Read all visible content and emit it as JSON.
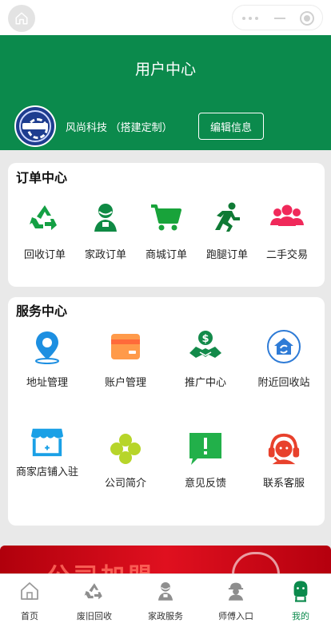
{
  "header": {
    "title": "用户中心",
    "user_name": "风尚科技 （搭建定制）",
    "edit_label": "编辑信息"
  },
  "orders": {
    "title": "订单中心",
    "items": [
      {
        "label": "回收订单",
        "icon": "recycle-icon"
      },
      {
        "label": "家政订单",
        "icon": "housekeeper-icon"
      },
      {
        "label": "商城订单",
        "icon": "cart-icon"
      },
      {
        "label": "跑腿订单",
        "icon": "runner-icon"
      },
      {
        "label": "二手交易",
        "icon": "people-group-icon"
      }
    ]
  },
  "services": {
    "title": "服务中心",
    "items": [
      {
        "label": "地址管理",
        "icon": "location-pin-icon"
      },
      {
        "label": "账户管理",
        "icon": "wallet-card-icon"
      },
      {
        "label": "推广中心",
        "icon": "money-handshake-icon"
      },
      {
        "label": "附近回收站",
        "icon": "recycle-house-icon"
      },
      {
        "label": "商家店铺入驻",
        "icon": "storefront-icon"
      },
      {
        "label": "公司简介",
        "icon": "clover-icon"
      },
      {
        "label": "意见反馈",
        "icon": "feedback-icon"
      },
      {
        "label": "联系客服",
        "icon": "headset-support-icon"
      }
    ]
  },
  "banner": {
    "text": "公司加盟"
  },
  "tabbar": {
    "items": [
      {
        "label": "首页",
        "icon": "home-icon"
      },
      {
        "label": "废旧回收",
        "icon": "recycle-icon"
      },
      {
        "label": "家政服务",
        "icon": "housekeeper-icon"
      },
      {
        "label": "师傅入口",
        "icon": "worker-icon"
      },
      {
        "label": "我的",
        "icon": "profile-icon"
      }
    ],
    "active": "我的"
  },
  "colors": {
    "brand_green": "#0b8a4c",
    "page_bg": "#e9e9e9",
    "accent_pink": "#f0295a",
    "banner_red": "#d10f1c"
  }
}
